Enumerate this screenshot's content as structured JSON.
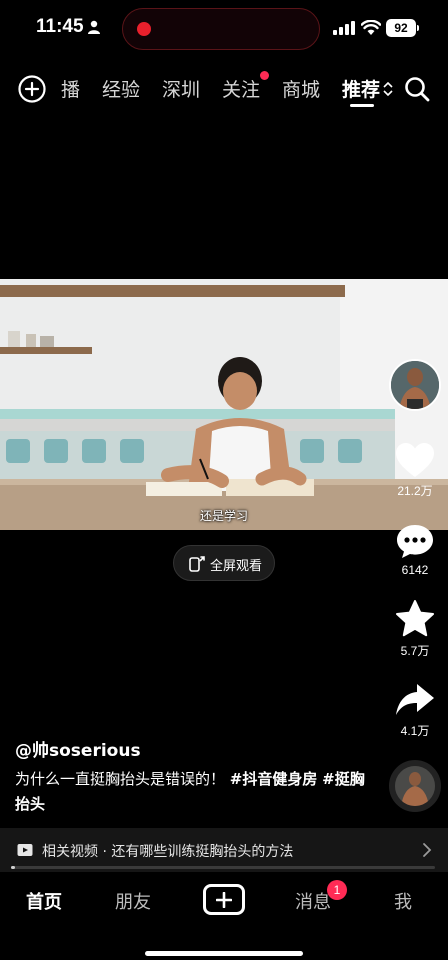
{
  "status_bar": {
    "time": "11:45",
    "battery": "92"
  },
  "top_nav": {
    "tabs": [
      {
        "label": "播"
      },
      {
        "label": "经验"
      },
      {
        "label": "深圳"
      },
      {
        "label": "关注"
      },
      {
        "label": "商城"
      },
      {
        "label": "推荐"
      }
    ]
  },
  "video": {
    "subtitle": "还是学习",
    "fullscreen_label": "全屏观看"
  },
  "actions": {
    "likes": "21.2万",
    "comments": "6142",
    "favorites": "5.7万",
    "shares": "4.1万"
  },
  "caption": {
    "author": "@帅soserious",
    "text": "为什么一直挺胸抬头是错误的！",
    "hashtags": [
      "#抖音健身房",
      "#挺胸抬头"
    ]
  },
  "related": {
    "text": "相关视频 · 还有哪些训练挺胸抬头的方法"
  },
  "progress": 0.01,
  "bottom_nav": {
    "items": [
      {
        "label": "首页"
      },
      {
        "label": "朋友"
      },
      {
        "label": "消息"
      },
      {
        "label": "我"
      }
    ],
    "messages_badge": "1"
  },
  "colors": {
    "accent": "#ff2b55",
    "recording": "#e8202c"
  },
  "icons": [
    "person-icon",
    "signal-icon",
    "wifi-icon",
    "add-circle-icon",
    "sort-icon",
    "search-icon",
    "fullscreen-icon",
    "heart-icon",
    "comment-icon",
    "star-icon",
    "share-icon",
    "related-video-icon",
    "chevron-right-icon",
    "plus-icon"
  ]
}
